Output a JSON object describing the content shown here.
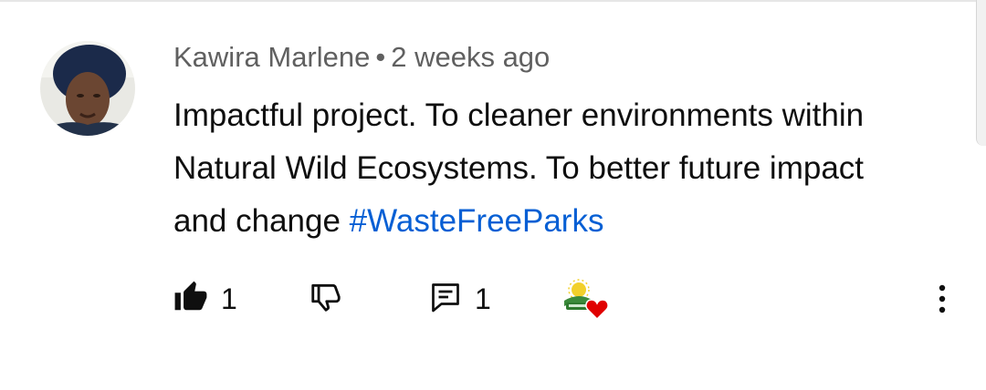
{
  "comment": {
    "author": "Kawira Marlene",
    "separator": "•",
    "time": "2 weeks ago",
    "text": "Impactful project. To cleaner environments within Natural Wild Ecosystems. To better future impact and change ",
    "hashtag": "#WasteFreeParks"
  },
  "actions": {
    "like_count": "1",
    "reply_count": "1",
    "icons": [
      "thumbs-up-icon",
      "thumbs-down-icon",
      "comment-reply-icon",
      "creator-heart-icon",
      "more-vert-icon"
    ]
  },
  "colors": {
    "text": "#0f0f0f",
    "meta": "#606060",
    "link": "#065fd4",
    "heart": "#e00000"
  }
}
